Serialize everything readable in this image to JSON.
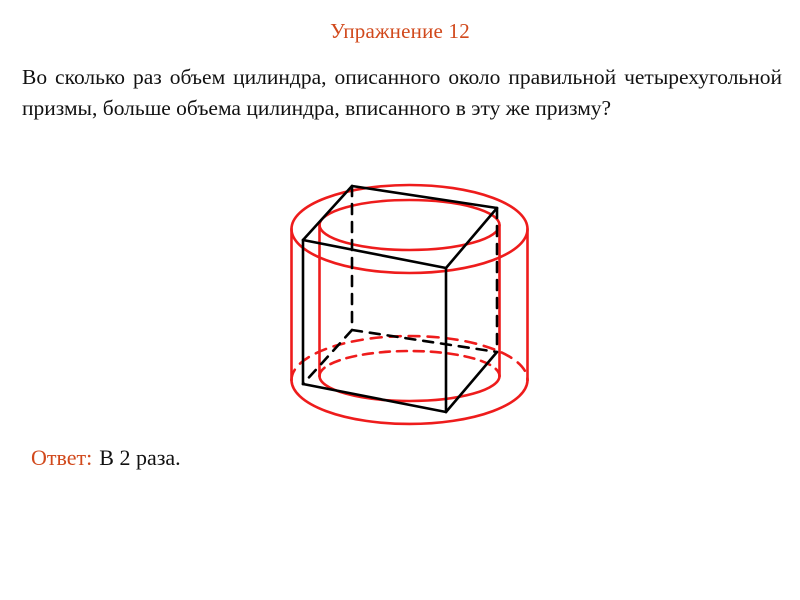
{
  "slide": {
    "background_color": "#ffffff",
    "accent_color": "#d1491c",
    "figure_red": "#ee1c1c",
    "figure_black": "#000000"
  },
  "header": {
    "title": "Упражнение 12"
  },
  "problem": {
    "text": "Во сколько раз объем цилиндра, описанного около правильной четырехугольной призмы, больше объема цилиндра, вписанного в эту же призму?"
  },
  "answer": {
    "label": "Ответ:",
    "value": "В 2 раза."
  },
  "figure": {
    "caption": "circumscribed-and-inscribed-cylinders-around-square-prism",
    "elements": [
      "outer-cylinder-circumscribed",
      "inner-cylinder-inscribed",
      "square-prism"
    ]
  }
}
